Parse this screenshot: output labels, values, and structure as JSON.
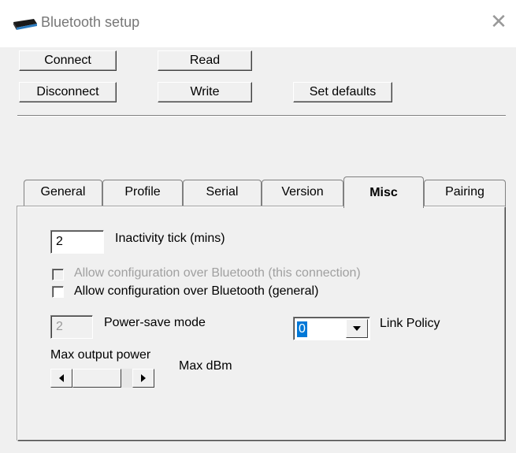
{
  "window": {
    "title": "Bluetooth setup",
    "close_glyph": "✕"
  },
  "toolbar": {
    "connect": "Connect",
    "disconnect": "Disconnect",
    "read": "Read",
    "write": "Write",
    "set_defaults": "Set defaults"
  },
  "tabs": [
    {
      "label": "General",
      "active": false
    },
    {
      "label": "Profile",
      "active": false
    },
    {
      "label": "Serial",
      "active": false
    },
    {
      "label": "Version",
      "active": false
    },
    {
      "label": "Misc",
      "active": true
    },
    {
      "label": "Pairing",
      "active": false
    }
  ],
  "misc": {
    "inactivity_value": "2",
    "inactivity_label": "Inactivity tick (mins)",
    "allow_config_connection_label": "Allow configuration over Bluetooth (this connection)",
    "allow_config_connection_checked": false,
    "allow_config_general_label": "Allow configuration over Bluetooth (general)",
    "allow_config_general_checked": false,
    "power_save_value": "2",
    "power_save_label": "Power-save mode",
    "link_policy_value": "0",
    "link_policy_label": "Link Policy",
    "max_output_power_label": "Max output power",
    "max_dbm_label": "Max dBm"
  },
  "icons": {
    "app": "bluetooth-device-icon",
    "close": "close-icon",
    "dropdown": "chevron-down-icon",
    "scroll_left": "arrow-left-icon",
    "scroll_right": "arrow-right-icon"
  }
}
